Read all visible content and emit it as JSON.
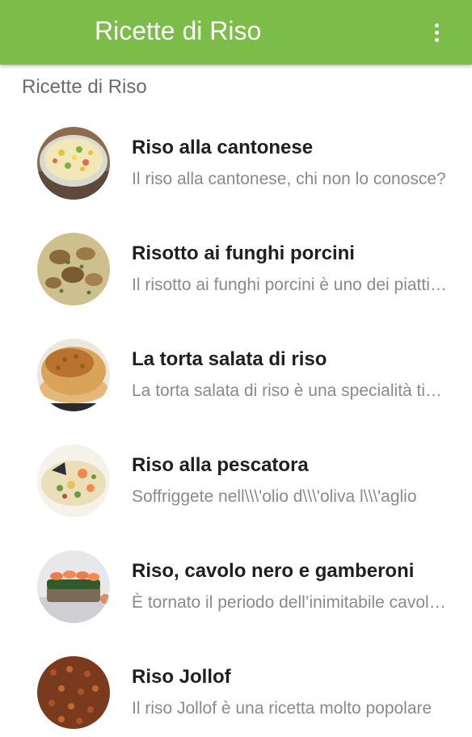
{
  "app_bar": {
    "title": "Ricette di Riso",
    "overflow_icon": "more-vert-icon",
    "color": "#7cbd4a"
  },
  "section": {
    "header": "Ricette di Riso"
  },
  "recipes": [
    {
      "title": "Riso alla cantonese",
      "description": "Il riso alla cantonese, chi non lo conosce?",
      "image": "fried-rice-bowl"
    },
    {
      "title": "Risotto ai funghi porcini",
      "description": "Il risotto ai funghi porcini è uno dei piatti più amati",
      "image": "mushroom-risotto"
    },
    {
      "title": "La torta salata di riso",
      "description": "La torta salata di riso è una specialità tipica",
      "image": "rice-savory-pie"
    },
    {
      "title": "Riso alla pescatora",
      "description": "Soffriggete nell\\\\\\'olio d\\\\\\'oliva l\\\\\\'aglio",
      "image": "seafood-rice"
    },
    {
      "title": "Riso, cavolo nero e gamberoni",
      "description": "È tornato il periodo dell’inimitabile cavolo nero",
      "image": "rice-kale-prawns"
    },
    {
      "title": "Riso Jollof",
      "description": "Il riso Jollof è una ricetta molto popolare",
      "image": "jollof-rice"
    }
  ]
}
